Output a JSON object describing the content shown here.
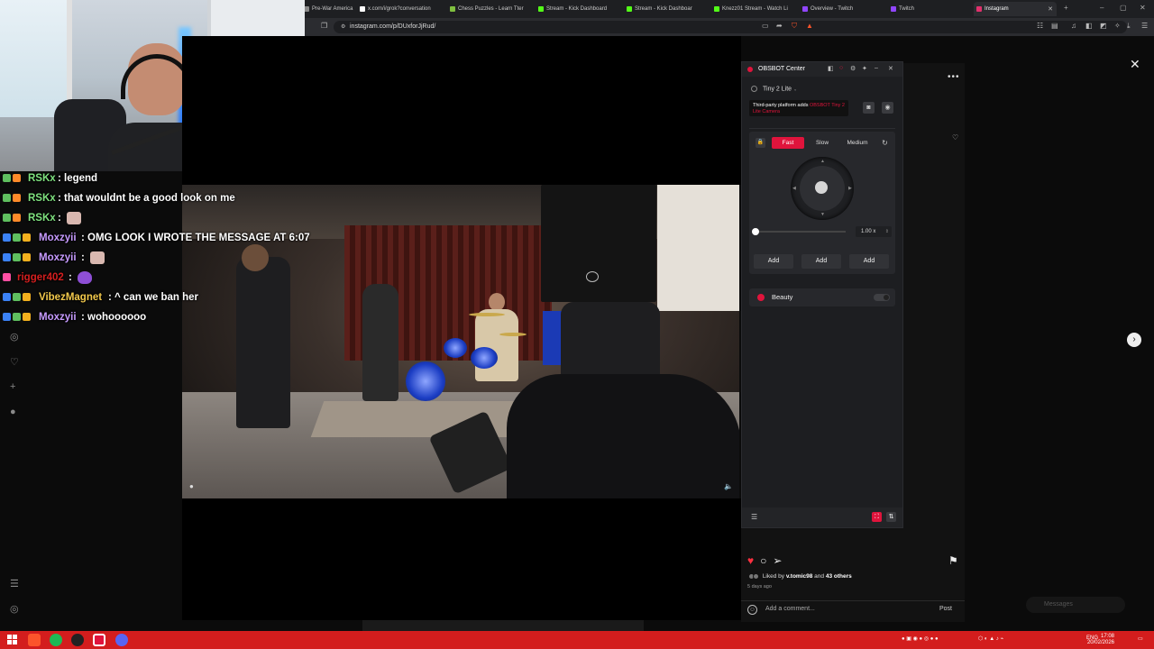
{
  "browser": {
    "tabs": [
      {
        "label": "Pre-War America",
        "color": "#888888"
      },
      {
        "label": "x.com/i/grok?conversation",
        "color": "#ffffff"
      },
      {
        "label": "Chess Puzzles - Learn Tter",
        "color": "#7fbf3f"
      },
      {
        "label": "Stream - Kick Dashboard",
        "color": "#53fc18"
      },
      {
        "label": "Stream - Kick Dashboar",
        "color": "#53fc18"
      },
      {
        "label": "Knezz01 Stream - Watch Li",
        "color": "#53fc18"
      },
      {
        "label": "Overview - Twitch",
        "color": "#9146ff"
      },
      {
        "label": "Twitch",
        "color": "#9146ff"
      },
      {
        "label": "Instagram",
        "color": "#e1306c"
      }
    ],
    "url": "instagram.com/p/DUxforJjRud/"
  },
  "chat": {
    "messages": [
      {
        "user": "RSKx",
        "text": ": legend",
        "user_color": "#7fe27f"
      },
      {
        "user": "RSKx",
        "text": ": that wouldnt be a good look on me",
        "user_color": "#7fe27f"
      },
      {
        "user": "RSKx",
        "text": ":",
        "user_color": "#7fe27f",
        "emote": "cat-emote"
      },
      {
        "user": "Moxzyii",
        "text": ": OMG LOOK I WROTE THE MESSAGE AT 6:07",
        "user_color": "#c79bff"
      },
      {
        "user": "Moxzyii",
        "text": ":",
        "user_color": "#c79bff",
        "emote": "cat-emote"
      },
      {
        "user": "rigger402",
        "text": ":",
        "user_color": "#d61f1f",
        "emote": "purple-heart"
      },
      {
        "user": "VibezMagnet",
        "text": ": ^ can we ban her",
        "user_color": "#f2c94c"
      },
      {
        "user": "Moxzyii",
        "text": ": wohoooooo",
        "user_color": "#c79bff"
      }
    ]
  },
  "obsbot": {
    "title": "OBSBOT Center",
    "device": "Tiny 2 Lite",
    "notice_prefix": "Third-party platform adds ",
    "notice_brand": "OBSBOT Tiny 2 Lite Camera",
    "speeds": [
      "Fast",
      "Slow",
      "Medium"
    ],
    "selected_speed": "Fast",
    "zoom_value": "1.00 x",
    "zoom_level": 0.0,
    "preset_buttons": [
      "Add",
      "Add",
      "Add"
    ],
    "beauty_label": "Beauty",
    "beauty_enabled": false
  },
  "instagram": {
    "liked_by_prefix": "Liked by ",
    "liked_by_user": "v.tomic98",
    "liked_by_suffix": " and ",
    "liked_by_others": "43 others",
    "date": "5 days ago",
    "comment_placeholder": "Add a comment...",
    "post_label": "Post",
    "messages_label": "Messages",
    "liked": true
  },
  "system": {
    "language": "ENG",
    "time": "17:08",
    "date": "20/02/2026"
  },
  "colors": {
    "accent": "#e0143c",
    "taskbar": "#d31d1d"
  }
}
